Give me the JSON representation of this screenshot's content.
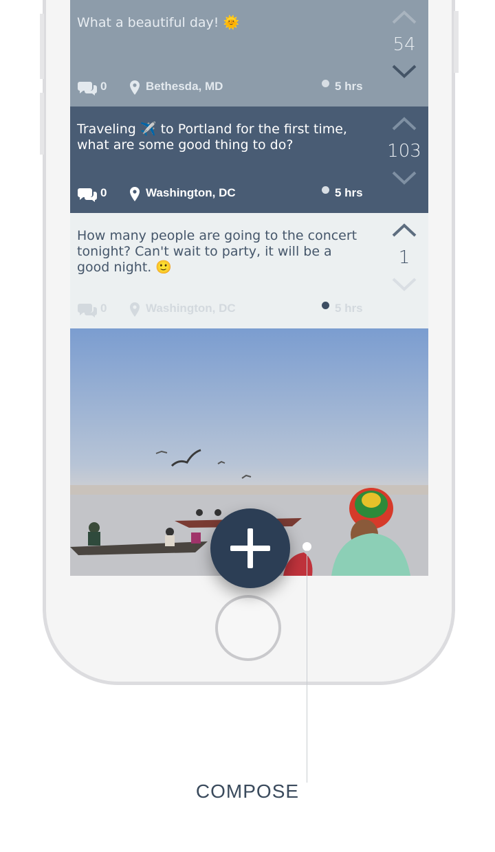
{
  "feed": {
    "posts": [
      {
        "text": "What a beautiful day! 🌞",
        "comments": "0",
        "location": "Bethesda, MD",
        "time": "5 hrs",
        "score": "54"
      },
      {
        "text": "Traveling ✈️ to Portland for the first time, what are some good thing to do?",
        "comments": "0",
        "location": "Washington, DC",
        "time": "5 hrs",
        "score": "103"
      },
      {
        "text": "How many people are going to the concert tonight? Can't wait to party, it will be a good night. 🙂",
        "comments": "0",
        "location": "Washington, DC",
        "time": "5 hrs",
        "score": "1"
      }
    ]
  },
  "compose": {
    "label": "COMPOSE",
    "icon": "plus-icon"
  },
  "colors": {
    "post_light": "#8d9caa",
    "post_dark": "#495c74",
    "post_plain": "#ecf0f1",
    "fab": "#2c3e55"
  }
}
